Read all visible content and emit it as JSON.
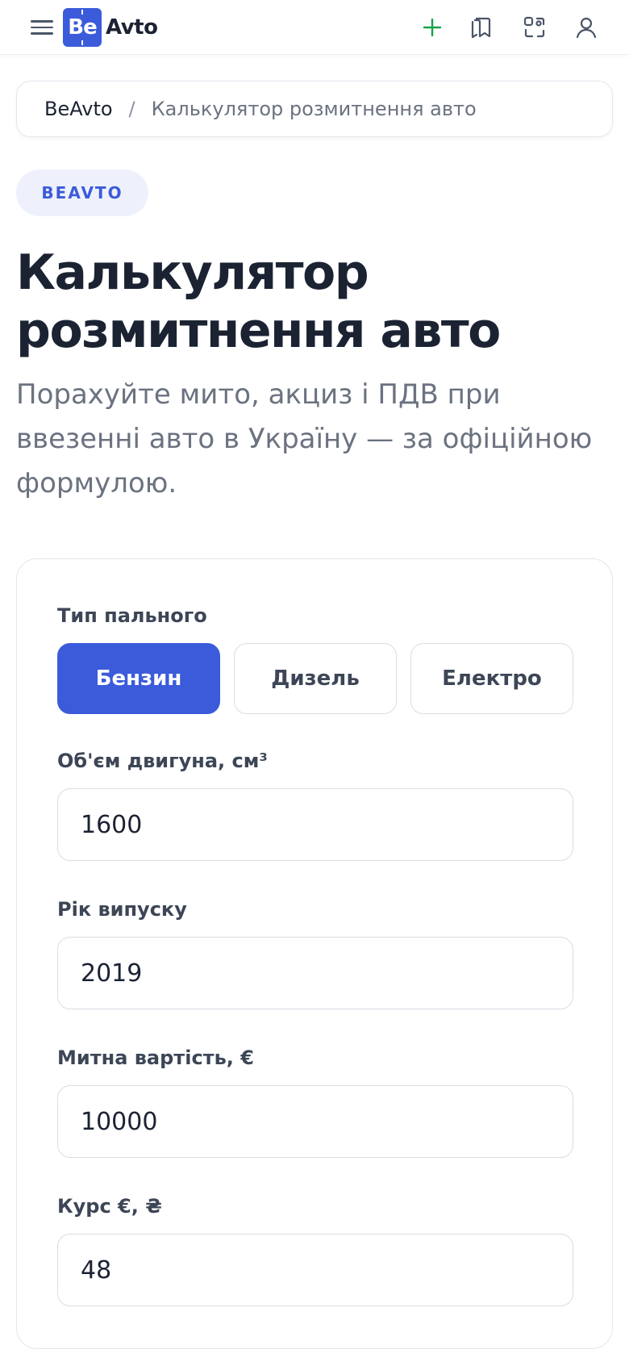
{
  "header": {
    "logo_mark": "Be",
    "logo_text": "Avto",
    "accent_color": "#3b5bdb",
    "plus_color": "#16a34a",
    "icons": [
      "menu-icon",
      "plus-icon",
      "bookmarks-icon",
      "scan-icon",
      "user-icon"
    ]
  },
  "breadcrumb": {
    "home": "BeAvto",
    "separator": "/",
    "current": "Калькулятор розмитнення авто"
  },
  "badge": "BEAVTO",
  "page": {
    "title": "Калькулятор розмитнення авто",
    "subtitle": "Порахуйте мито, акциз і ПДВ при ввезенні авто в Україну — за офіційною формулою."
  },
  "form": {
    "fuel_label": "Тип пального",
    "fuel_options": [
      "Бензин",
      "Дизель",
      "Електро"
    ],
    "fuel_selected": "Бензин",
    "engine_label": "Об'єм двигуна, см³",
    "engine_value": "1600",
    "year_label": "Рік випуску",
    "year_value": "2019",
    "price_label": "Митна вартість, €",
    "price_value": "10000",
    "rate_label": "Курс €, ₴",
    "rate_value": "48"
  }
}
